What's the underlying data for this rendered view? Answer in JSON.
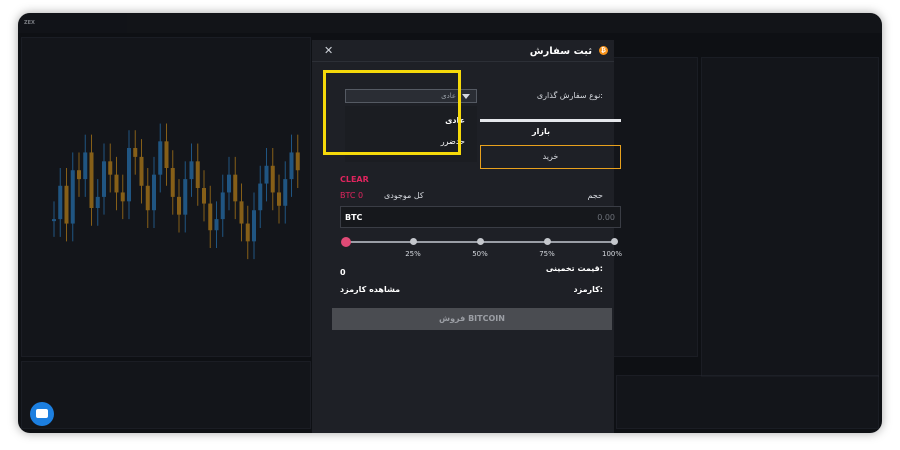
{
  "modal": {
    "title": "ثبت سفارش",
    "order_type_label": "نوع سفارش گذاری:",
    "order_type_value": "عادی",
    "order_type_options": [
      "عادی",
      "حدضرر"
    ],
    "tab_market": "بازار",
    "buy_button": "خرید",
    "clear": "CLEAR",
    "volume_label": "حجم",
    "balance_label": "کل موجودی",
    "balance_value": "BTC 0",
    "input_currency": "BTC",
    "input_value": "0.00",
    "percent_marks": [
      "25%",
      "50%",
      "75%",
      "100%"
    ],
    "estimated_price_label": "قیمت تخمینی:",
    "estimated_price_value": "0",
    "fee_label": "کارمزد:",
    "fee_link": "مشاهده کارمزد",
    "sell_button": "فروش BITCOIN"
  },
  "colors": {
    "accent_orange": "#e8a11d",
    "clear_red": "#e0245e",
    "highlight_yellow": "#f5d90a",
    "chat_blue": "#1c7fe0"
  },
  "chart_series": {
    "candles": [
      40,
      55,
      38,
      62,
      58,
      70,
      45,
      50,
      66,
      60,
      52,
      48,
      72,
      68,
      55,
      44,
      60,
      75,
      63,
      50,
      42,
      58,
      66,
      54,
      47,
      35,
      40,
      52,
      60,
      48,
      38,
      30,
      44,
      56,
      64,
      52,
      46,
      58,
      70,
      62
    ]
  }
}
